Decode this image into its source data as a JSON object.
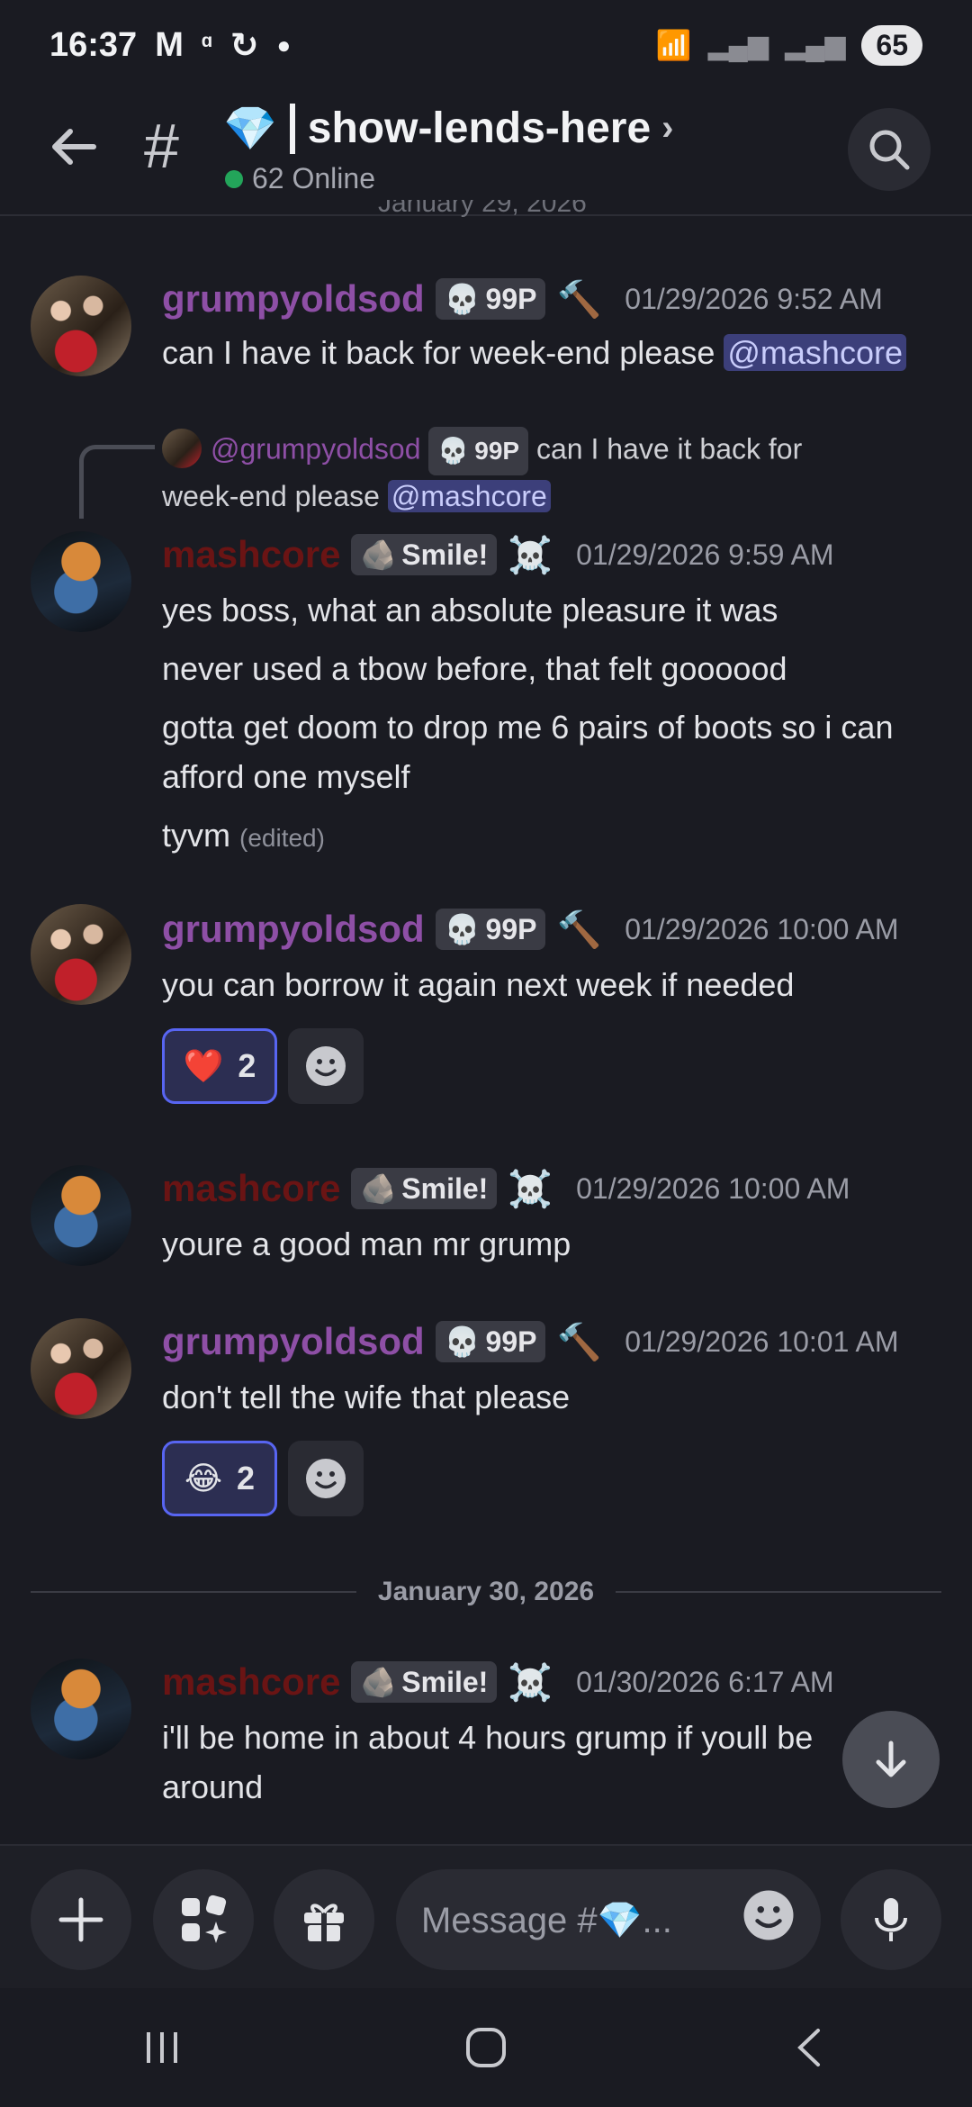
{
  "status_bar": {
    "time": "16:37",
    "battery": "65"
  },
  "header": {
    "channel_name": "show-lends-here",
    "channel_emoji": "💎",
    "online_count": "62 Online",
    "partial_date": "January 29, 2026"
  },
  "messages": [
    {
      "author": "grumpyoldsod",
      "tag": "99P",
      "timestamp": "01/29/2026 9:52 AM",
      "text": "can I have it back for week-end please",
      "mention": "@mashcore"
    },
    {
      "reply": {
        "author": "@grumpyoldsod",
        "tag": "99P",
        "text_a": "can I have it back for",
        "text_b": "week-end please",
        "mention": "@mashcore"
      },
      "author": "mashcore",
      "tag": "Smile!",
      "timestamp": "01/29/2026 9:59 AM",
      "lines": [
        "yes boss, what an absolute pleasure it was",
        "never used a tbow before, that felt goooood",
        "gotta get doom to drop me 6 pairs of boots so i can afford one myself",
        "tyvm"
      ],
      "edited": "(edited)"
    },
    {
      "author": "grumpyoldsod",
      "tag": "99P",
      "timestamp": "01/29/2026 10:00 AM",
      "text": "you can borrow it again next week if needed",
      "reaction": {
        "emoji": "❤️",
        "count": "2"
      }
    },
    {
      "author": "mashcore",
      "tag": "Smile!",
      "timestamp": "01/29/2026 10:00 AM",
      "text": "youre a good man mr grump"
    },
    {
      "author": "grumpyoldsod",
      "tag": "99P",
      "timestamp": "01/29/2026 10:01 AM",
      "text": "don't tell the wife that please",
      "reaction": {
        "emoji": "😂",
        "count": "2"
      }
    },
    {
      "author": "mashcore",
      "tag": "Smile!",
      "timestamp": "01/30/2026 6:17 AM",
      "text": "i'll be home in about 4 hours grump if youll be around"
    }
  ],
  "date_divider": "January 30, 2026",
  "composer": {
    "placeholder": "Message #💎..."
  },
  "icons": {
    "back": "arrow-left-icon",
    "search": "search-icon",
    "plus": "plus-icon",
    "apps": "apps-icon",
    "gift": "gift-icon",
    "emoji": "smiley-icon",
    "mic": "microphone-icon",
    "jump": "arrow-down-icon"
  }
}
